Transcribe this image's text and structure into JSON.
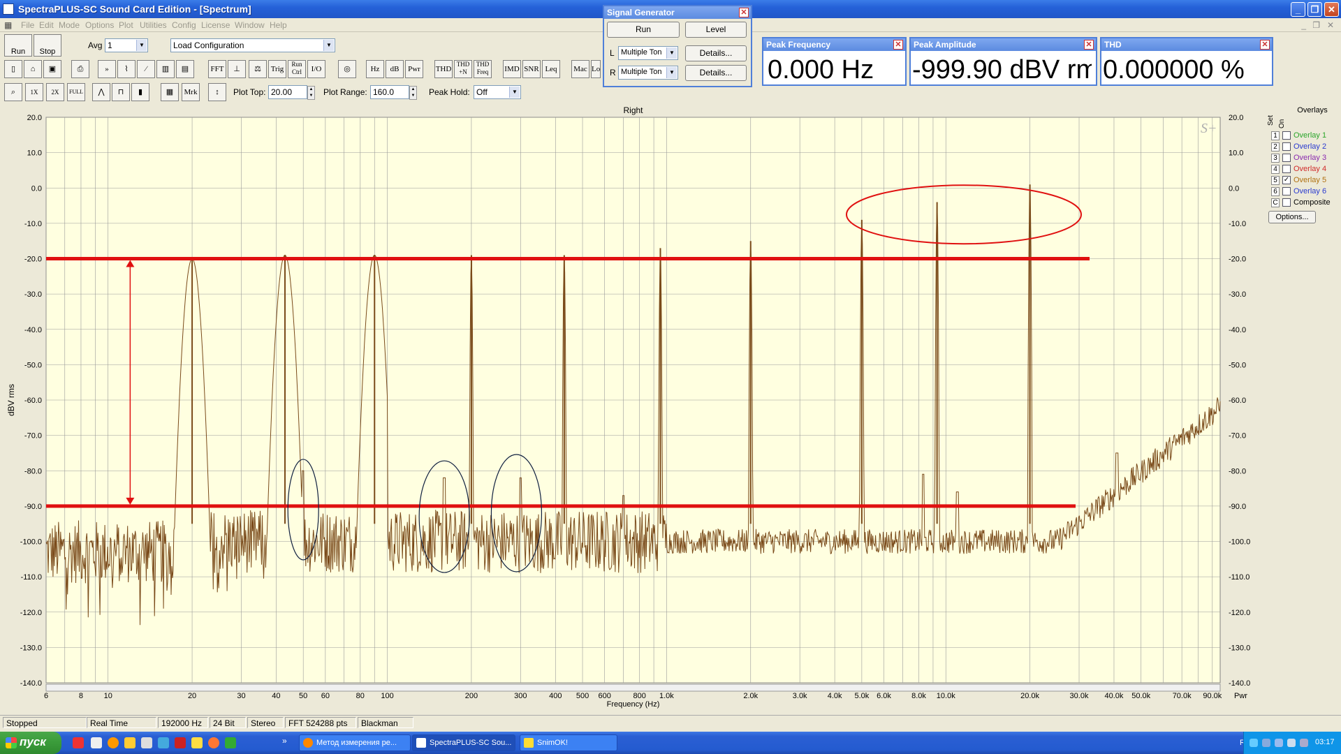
{
  "window": {
    "title": "SpectraPLUS-SC Sound Card Edition - [Spectrum]"
  },
  "menu": [
    "File",
    "Edit",
    "Mode",
    "Options",
    "Plot",
    "Utilities",
    "Config",
    "License",
    "Window",
    "Help"
  ],
  "toolbar1": {
    "run_label": "Run",
    "stop_label": "Stop",
    "avg_label": "Avg",
    "avg_value": "1",
    "config_value": "Load Configuration"
  },
  "toolbar2": {
    "buttons": [
      "FFT",
      "Trig",
      "Run Ctrl",
      "I/O",
      "Hz",
      "dB",
      "Pwr",
      "THD",
      "THD +N",
      "THD Freq",
      "IMD",
      "SNR",
      "Leq",
      "Mac",
      "Lo"
    ]
  },
  "toolbar3": {
    "buttons": [
      "1X",
      "2X",
      "FULL",
      "Mrk"
    ],
    "plot_top_label": "Plot Top:",
    "plot_top_value": "20.00",
    "plot_range_label": "Plot Range:",
    "plot_range_value": "160.0",
    "peak_hold_label": "Peak Hold:",
    "peak_hold_value": "Off"
  },
  "signal_generator": {
    "title": "Signal Generator",
    "run_label": "Run",
    "level_label": "Level",
    "left_label": "L",
    "right_label": "R",
    "left_value": "Multiple Ton",
    "right_value": "Multiple Ton",
    "details_label": "Details..."
  },
  "readouts": {
    "peak_frequency": {
      "title": "Peak Frequency",
      "value": "0.000 Hz"
    },
    "peak_amplitude": {
      "title": "Peak Amplitude",
      "value": "-999.90 dBV rm"
    },
    "thd": {
      "title": "THD",
      "value": "0.000000 %"
    }
  },
  "overlays": {
    "title": "Overlays",
    "col_set": "Set",
    "col_on": "On",
    "items": [
      {
        "num": "1",
        "name": "Overlay 1",
        "color": "#2aa52a",
        "checked": false
      },
      {
        "num": "2",
        "name": "Overlay 2",
        "color": "#2a3ad0",
        "checked": false
      },
      {
        "num": "3",
        "name": "Overlay 3",
        "color": "#8a2ab0",
        "checked": false
      },
      {
        "num": "4",
        "name": "Overlay 4",
        "color": "#d02a2a",
        "checked": false
      },
      {
        "num": "5",
        "name": "Overlay 5",
        "color": "#b07010",
        "checked": true
      },
      {
        "num": "6",
        "name": "Overlay 6",
        "color": "#2a3ad0",
        "checked": false
      },
      {
        "num": "C",
        "name": "Composite",
        "color": "#000000",
        "checked": false
      }
    ],
    "options_label": "Options..."
  },
  "chart_data": {
    "type": "line",
    "title": "Right",
    "xlabel": "Frequency (Hz)",
    "ylabel": "dBV rms",
    "x_scale": "log",
    "xlim": [
      6,
      96000
    ],
    "ylim": [
      -140,
      20
    ],
    "grid": true,
    "watermark": "S+",
    "pwr_label": "Pwr",
    "y_ticks": [
      "20.0",
      "10.0",
      "0.0",
      "-10.0",
      "-20.0",
      "-30.0",
      "-40.0",
      "-50.0",
      "-60.0",
      "-70.0",
      "-80.0",
      "-90.0",
      "-100.0",
      "-110.0",
      "-120.0",
      "-130.0",
      "-140.0"
    ],
    "x_ticks": [
      {
        "v": 6,
        "t": "6"
      },
      {
        "v": 8,
        "t": "8"
      },
      {
        "v": 10,
        "t": "10"
      },
      {
        "v": 20,
        "t": "20"
      },
      {
        "v": 30,
        "t": "30"
      },
      {
        "v": 40,
        "t": "40"
      },
      {
        "v": 50,
        "t": "50"
      },
      {
        "v": 60,
        "t": "60"
      },
      {
        "v": 80,
        "t": "80"
      },
      {
        "v": 100,
        "t": "100"
      },
      {
        "v": 200,
        "t": "200"
      },
      {
        "v": 300,
        "t": "300"
      },
      {
        "v": 400,
        "t": "400"
      },
      {
        "v": 500,
        "t": "500"
      },
      {
        "v": 600,
        "t": "600"
      },
      {
        "v": 800,
        "t": "800"
      },
      {
        "v": 1000,
        "t": "1.0k"
      },
      {
        "v": 2000,
        "t": "2.0k"
      },
      {
        "v": 3000,
        "t": "3.0k"
      },
      {
        "v": 4000,
        "t": "4.0k"
      },
      {
        "v": 5000,
        "t": "5.0k"
      },
      {
        "v": 6000,
        "t": "6.0k"
      },
      {
        "v": 8000,
        "t": "8.0k"
      },
      {
        "v": 10000,
        "t": "10.0k"
      },
      {
        "v": 20000,
        "t": "20.0k"
      },
      {
        "v": 30000,
        "t": "30.0k"
      },
      {
        "v": 40000,
        "t": "40.0k"
      },
      {
        "v": 50000,
        "t": "50.0k"
      },
      {
        "v": 70000,
        "t": "70.0k"
      },
      {
        "v": 90000,
        "t": "90.0k"
      }
    ],
    "peaks": [
      {
        "f": 20,
        "db": -20
      },
      {
        "f": 43,
        "db": -19
      },
      {
        "f": 90,
        "db": -19
      },
      {
        "f": 200,
        "db": -19
      },
      {
        "f": 430,
        "db": -19
      },
      {
        "f": 950,
        "db": -17
      },
      {
        "f": 2000,
        "db": -15
      },
      {
        "f": 5000,
        "db": -9
      },
      {
        "f": 9300,
        "db": -4
      },
      {
        "f": 20000,
        "db": 1
      }
    ],
    "minor_peaks": [
      {
        "f": 50,
        "db": -80
      },
      {
        "f": 160,
        "db": -82
      },
      {
        "f": 300,
        "db": -82
      },
      {
        "f": 700,
        "db": -87
      },
      {
        "f": 8300,
        "db": -81
      },
      {
        "f": 11000,
        "db": -86
      },
      {
        "f": 41000,
        "db": -75
      }
    ],
    "noise_floor_db": -100,
    "annotations": [
      {
        "type": "hline",
        "db": -20,
        "color": "#e01010"
      },
      {
        "type": "hline",
        "db": -90,
        "color": "#e01010"
      }
    ],
    "series_color": "#7a4a1a",
    "plot_bg": "#ffffe0",
    "annotation_color": "#e01010"
  },
  "status": {
    "state": "Stopped",
    "mode": "Real Time",
    "rate": "192000 Hz",
    "bits": "24 Bit",
    "channels": "Stereo",
    "fft": "FFT 524288 pts",
    "window": "Blackman"
  },
  "taskbar": {
    "start_label": "пуск",
    "tasks": [
      "Метод измерения ре...",
      "SpectraPLUS-SC Sou...",
      "SnimOK!"
    ],
    "lang": "RU",
    "clock": "03:17"
  }
}
